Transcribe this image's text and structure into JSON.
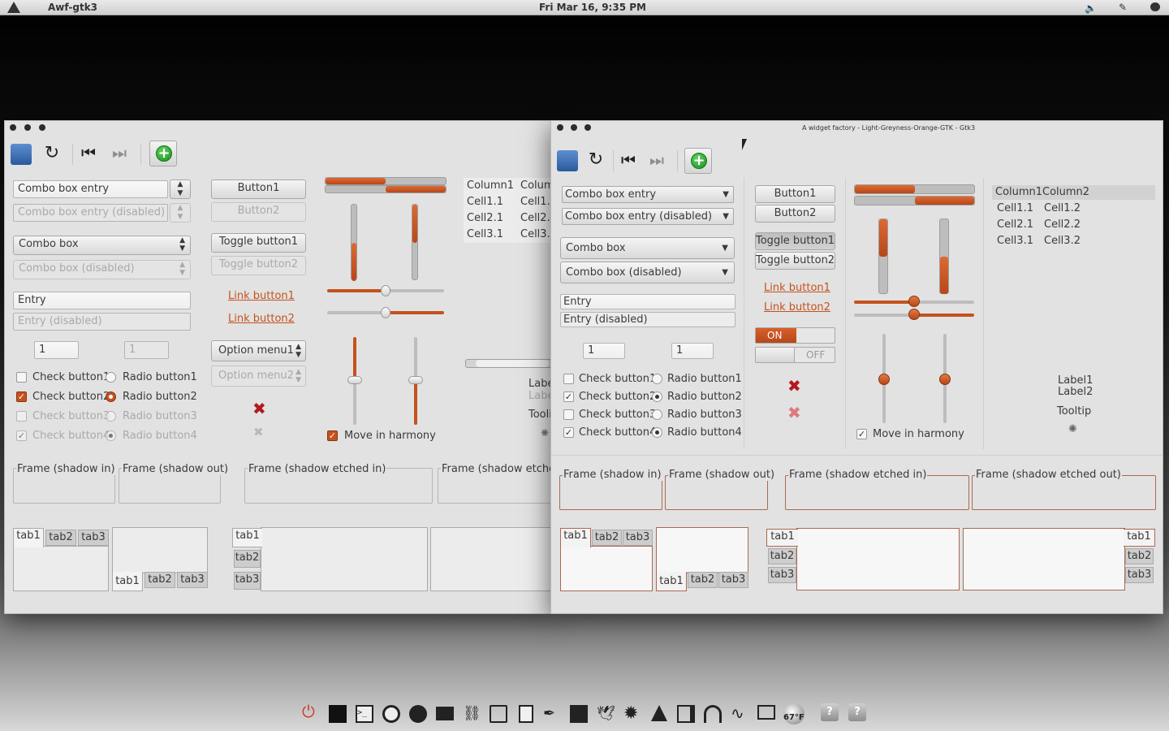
{
  "top_panel": {
    "app_name": "Awf-gtk3",
    "clock": "Fri Mar 16,  9:35 PM"
  },
  "left_window": {
    "combo_entry": "Combo box entry",
    "combo_entry_disabled": "Combo box entry (disabled)",
    "combo": "Combo box",
    "combo_disabled": "Combo box (disabled)",
    "entry": "Entry",
    "entry_disabled": "Entry (disabled)",
    "spin1": "1",
    "spin2": "1",
    "checks": [
      "Check button1",
      "Check button2",
      "Check button3",
      "Check button4"
    ],
    "radios": [
      "Radio button1",
      "Radio button2",
      "Radio button3",
      "Radio button4"
    ],
    "button1": "Button1",
    "button2": "Button2",
    "toggle1": "Toggle button1",
    "toggle2": "Toggle button2",
    "link1": "Link button1",
    "link2": "Link button2",
    "option1": "Option menu1",
    "option2": "Option menu2",
    "move_harmony": "Move in harmony",
    "tree_headers": [
      "Column1",
      "Colum"
    ],
    "tree_rows": [
      [
        "Cell1.1",
        "Cell1.2"
      ],
      [
        "Cell2.1",
        "Cell2.2"
      ],
      [
        "Cell3.1",
        "Cell3.2"
      ]
    ],
    "label1": "Labe",
    "label2": "Labe",
    "tooltip": "Tooli",
    "frames": [
      "Frame (shadow in)",
      "Frame (shadow out)",
      "Frame (shadow etched in)",
      "Frame (shadow etched"
    ],
    "tabs": [
      "tab1",
      "tab2",
      "tab3"
    ]
  },
  "right_window": {
    "title": "A widget factory - Light-Greyness-Orange-GTK - Gtk3",
    "combo_entry": "Combo box entry",
    "combo_entry_disabled": "Combo box entry (disabled)",
    "combo": "Combo box",
    "combo_disabled": "Combo box (disabled)",
    "entry": "Entry",
    "entry_disabled": "Entry (disabled)",
    "spin1": "1",
    "spin2": "1",
    "checks": [
      "Check button1",
      "Check button2",
      "Check button3",
      "Check button4"
    ],
    "radios": [
      "Radio button1",
      "Radio button2",
      "Radio button3",
      "Radio button4"
    ],
    "button1": "Button1",
    "button2": "Button2",
    "toggle1": "Toggle button1",
    "toggle2": "Toggle button2",
    "link1": "Link button1",
    "link2": "Link button2",
    "switch_on": "ON",
    "switch_off": "OFF",
    "move_harmony": "Move in harmony",
    "tree_headers": [
      "Column1",
      "Column2"
    ],
    "tree_rows": [
      [
        "Cell1.1",
        "Cell1.2"
      ],
      [
        "Cell2.1",
        "Cell2.2"
      ],
      [
        "Cell3.1",
        "Cell3.2"
      ]
    ],
    "label1": "Label1",
    "label2": "Label2",
    "tooltip": "Tooltip",
    "frames": [
      "Frame (shadow in)",
      "Frame (shadow out)",
      "Frame (shadow etched in)",
      "Frame (shadow etched out)"
    ],
    "tabs": [
      "tab1",
      "tab2",
      "tab3"
    ]
  },
  "dock": {
    "temperature": "67°F"
  },
  "colors": {
    "accent": "#c4521d",
    "danger": "#b3191f",
    "add": "#2ea832"
  }
}
